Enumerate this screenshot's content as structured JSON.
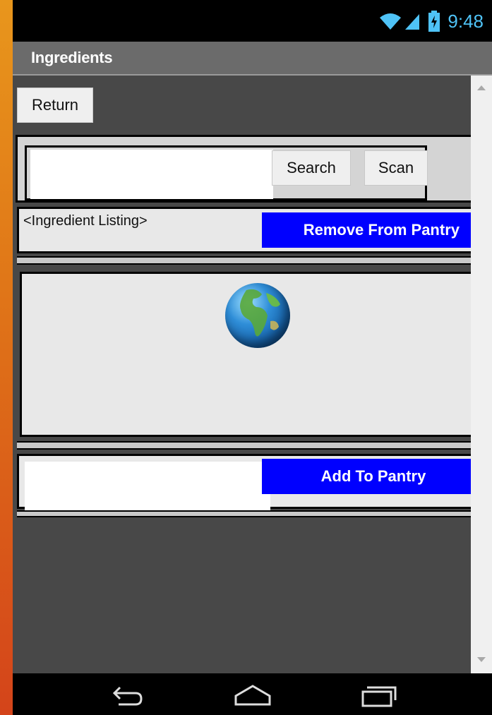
{
  "status_bar": {
    "time": "9:48",
    "icons": [
      "wifi-icon",
      "signal-icon",
      "battery-charging-icon"
    ],
    "accent_color": "#4fc3f7"
  },
  "title_bar": {
    "title": "Ingredients"
  },
  "toolbar": {
    "return_label": "Return"
  },
  "search": {
    "value": "",
    "search_label": "Search",
    "scan_label": "Scan"
  },
  "ingredient": {
    "listing_label": "<Ingredient Listing>",
    "remove_label": "Remove From Pantry"
  },
  "image_area": {
    "icon": "globe-icon"
  },
  "pantry": {
    "value": "",
    "add_label": "Add To Pantry"
  },
  "nav_bar": {
    "icons": [
      "back-icon",
      "home-icon",
      "recents-icon"
    ]
  },
  "colors": {
    "primary_button": "#0000ff",
    "content_bg": "#484848",
    "title_bar_bg": "#6b6b6b"
  }
}
